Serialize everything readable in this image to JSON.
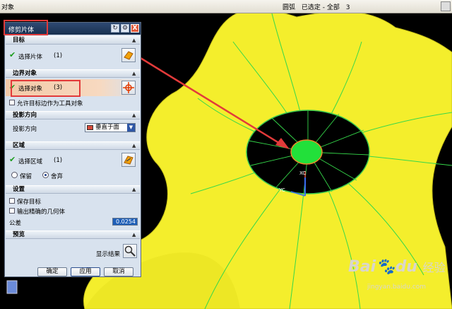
{
  "topbar": {
    "left_text": "对象",
    "filter": "圆弧",
    "selected_label": "已选定 - 全部",
    "selected_count": "3"
  },
  "dialog": {
    "title": "修剪片体",
    "reset_icon": "reset-icon",
    "settings_icon": "gear-icon",
    "close_label": "X",
    "target": {
      "header": "目标",
      "select_sheet": "选择片体",
      "count": "(1)"
    },
    "boundary": {
      "header": "边界对象",
      "select_object": "选择对象",
      "count": "(3)",
      "allow_target_edges": "允许目标边作为工具对象"
    },
    "projection": {
      "header": "投影方向",
      "label": "投影方向",
      "value": "垂直于面"
    },
    "region": {
      "header": "区域",
      "select_region": "选择区域",
      "count": "(1)",
      "keep": "保留",
      "discard": "舍弃",
      "selected": "discard"
    },
    "settings": {
      "header": "设置",
      "keep_target": "保存目标",
      "output_exact": "输出精确的几何体",
      "tolerance_label": "公差",
      "tolerance_value": "0.0254"
    },
    "preview": {
      "header": "预览",
      "show_result": "显示结果"
    },
    "buttons": {
      "ok": "确定",
      "apply": "应用",
      "cancel": "取消"
    }
  },
  "viewport": {
    "axis_x_label": "XC",
    "axis_y_label": "YC"
  },
  "watermark": {
    "brand": "Bai",
    "brand2": "du",
    "cn": "经验",
    "url": "jingyan.baidu.com"
  },
  "colors": {
    "surface": "#f4ee2c",
    "background": "#000000",
    "disc": "#000000",
    "selected_region": "#22e03a",
    "annotation": "#e23a3a"
  }
}
